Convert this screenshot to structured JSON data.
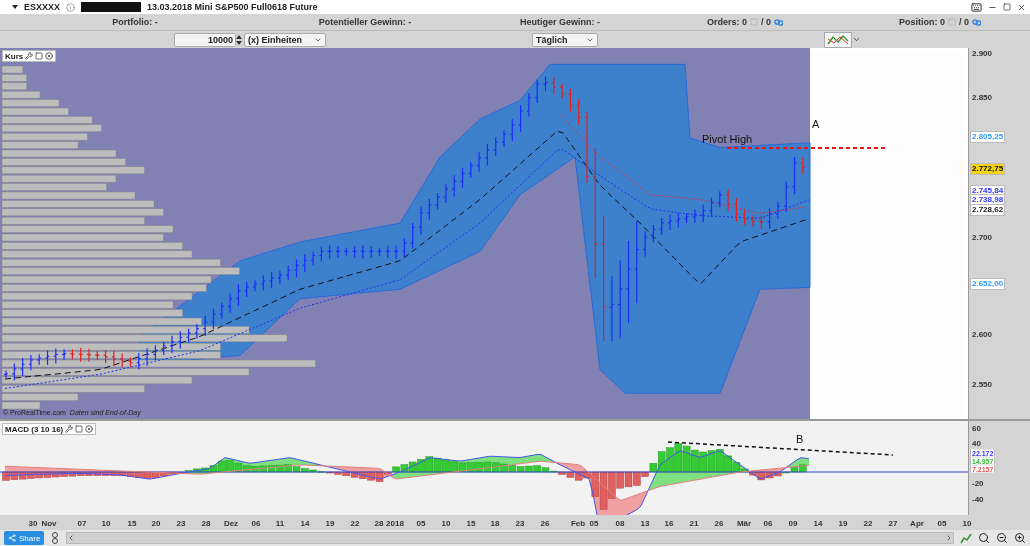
{
  "header": {
    "symbol": "ESXXXX",
    "title": "13.03.2018 Mini S&P500 Full0618 Future"
  },
  "info_bar": [
    {
      "kind": "text",
      "label": "Portfolio: -"
    },
    {
      "kind": "text",
      "label": "Potentieller Gewinn: -"
    },
    {
      "kind": "text",
      "label": "Heutiger Gewinn: -"
    },
    {
      "kind": "counter",
      "label": "Orders: 0",
      "count": "/ 0"
    },
    {
      "kind": "counter",
      "label": "Position: 0",
      "count": "/ 0"
    }
  ],
  "toolbar": {
    "quantity": "10000",
    "unit": "(x) Einheiten",
    "period": "Täglich"
  },
  "price_panel": {
    "title": "Kurs",
    "copyright": "© ProRealTime.com",
    "note": "Daten sind End-of-Day",
    "annotations": [
      {
        "text": "Pivot High"
      },
      {
        "text": "A"
      }
    ],
    "axis_ticks": [
      "2.900",
      "2.850",
      "2.700",
      "2.600",
      "2.550"
    ],
    "price_tags": [
      {
        "kind": "level",
        "text": "2.805,25",
        "color": "#3399ff"
      },
      {
        "kind": "current",
        "text": "2.772,75",
        "color": "#f2d21a"
      },
      {
        "kind": "level",
        "text": "2.745,84",
        "color": "#3333ff"
      },
      {
        "kind": "level",
        "text": "2.738,98",
        "color": "#3333ff"
      },
      {
        "kind": "level",
        "text": "2.728,62",
        "color": "#222222"
      },
      {
        "kind": "level",
        "text": "2.652,00",
        "color": "#3399ff"
      }
    ]
  },
  "macd_panel": {
    "title": "MACD (3 10 16)",
    "annotation": "B",
    "axis_ticks": [
      "60",
      "40",
      "-20",
      "-40"
    ],
    "value_tags": [
      {
        "text": "22.172",
        "color": "#3333ff"
      },
      {
        "text": "14.957",
        "color": "#33bb33"
      },
      {
        "text": "7.2157",
        "color": "#ee5555"
      }
    ]
  },
  "date_axis": [
    "30",
    "Nov",
    "07",
    "10",
    "15",
    "20",
    "23",
    "28",
    "Dez",
    "06",
    "11",
    "14",
    "19",
    "22",
    "28",
    "2018",
    "05",
    "10",
    "15",
    "18",
    "23",
    "26",
    "Feb",
    "05",
    "08",
    "13",
    "16",
    "21",
    "26",
    "Mär",
    "06",
    "09",
    "14",
    "19",
    "22",
    "27",
    "Apr",
    "05",
    "10"
  ],
  "bottom_bar": {
    "share": "Share"
  }
}
